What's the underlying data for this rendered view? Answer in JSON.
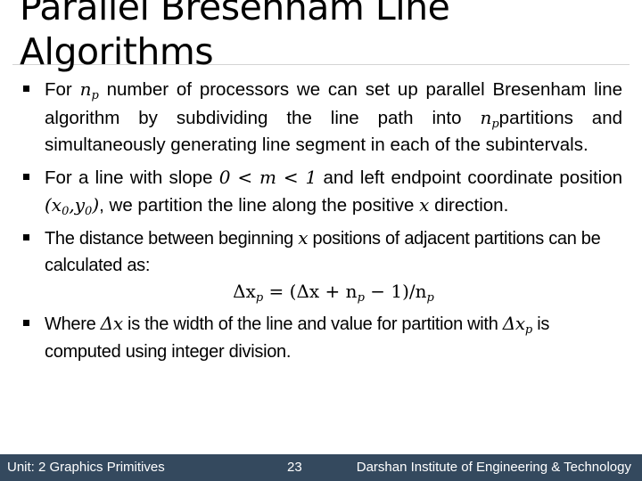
{
  "slide": {
    "title_line1": "Parallel Bresenham Line",
    "title_line2": "Algorithms",
    "bullets": [
      {
        "parts": [
          "For ",
          "n",
          "p",
          " number of processors we can set up parallel Bresenham line algorithm by subdividing the line path into ",
          "n",
          "p",
          "partitions and simultaneously generating line segment in each of the subintervals."
        ]
      },
      {
        "parts": [
          "For a line with slope ",
          "0 < m < 1",
          " and left endpoint coordinate position ",
          "(x",
          "0",
          ",y",
          "0",
          ")",
          ", we partition the line along the positive ",
          "x",
          " direction."
        ]
      },
      {
        "parts": [
          "The distance between beginning ",
          "x",
          " positions of adjacent partitions can be calculated as:"
        ]
      },
      {
        "parts": [
          "Where ",
          "Δx",
          " is the width of the line and value for partition with ",
          "Δx",
          "p",
          " is computed using integer division."
        ]
      }
    ],
    "formula": {
      "lhs": "Δx",
      "lhs_sub": "p",
      "eq": " = (Δx + n",
      "sub1": "p",
      "mid": " − 1)/n",
      "sub2": "p"
    }
  },
  "footer": {
    "unit": "Unit: 2 Graphics Primitives",
    "page": "23",
    "institute": "Darshan Institute of Engineering & Technology"
  },
  "colors": {
    "footer_bg": "#34495e",
    "footer_text": "#ffffff",
    "divider": "#d4d4d4"
  }
}
